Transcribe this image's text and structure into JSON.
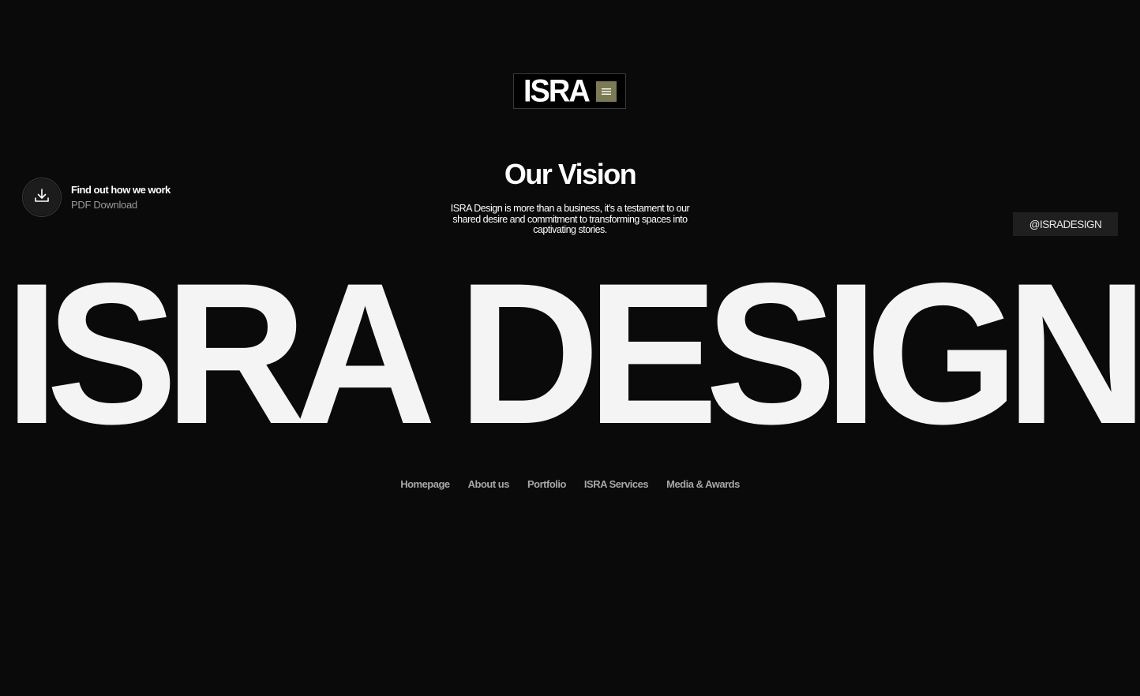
{
  "header": {
    "logo_text": "ISRA",
    "menu_icon": "hamburger-icon"
  },
  "download": {
    "icon": "download-icon",
    "title": "Find out how we work",
    "subtitle": "PDF Download"
  },
  "vision": {
    "title": "Our Vision",
    "text": "ISRA Design is more than a business, it's a testament to our shared desire and commitment to transforming spaces into captivating stories."
  },
  "social": {
    "handle": "@ISRADESIGN"
  },
  "hero": {
    "wordmark": "ISRA DESIGN"
  },
  "nav": {
    "items": [
      {
        "label": "Homepage"
      },
      {
        "label": "About us"
      },
      {
        "label": "Portfolio"
      },
      {
        "label": "ISRA Services"
      },
      {
        "label": "Media & Awards"
      }
    ]
  },
  "colors": {
    "background": "#0a0a0a",
    "accent": "#7c7a52",
    "text": "#ffffff",
    "muted": "#a6a6a6"
  }
}
